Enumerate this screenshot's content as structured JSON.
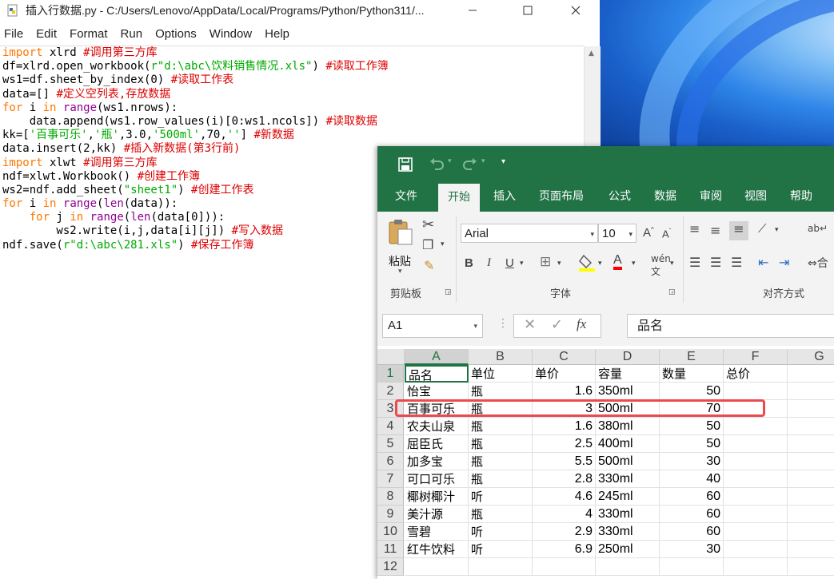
{
  "idle": {
    "title": "插入行数据.py - C:/Users/Lenovo/AppData/Local/Programs/Python/Python311/...",
    "menu": [
      "File",
      "Edit",
      "Format",
      "Run",
      "Options",
      "Window",
      "Help"
    ],
    "code": [
      [
        {
          "t": "import",
          "c": "kw"
        },
        {
          "t": " xlrd "
        },
        {
          "t": "#调用第三方库",
          "c": "cm"
        }
      ],
      [
        {
          "t": "df=xlrd.open_workbook("
        },
        {
          "t": "r\"d:\\abc\\饮料销售情况.xls\"",
          "c": "st"
        },
        {
          "t": ") "
        },
        {
          "t": "#读取工作簿",
          "c": "cm"
        }
      ],
      [
        {
          "t": "ws1=df.sheet_by_index(0) "
        },
        {
          "t": "#读取工作表",
          "c": "cm"
        }
      ],
      [
        {
          "t": "data=[] "
        },
        {
          "t": "#定义空列表,存放数据",
          "c": "cm"
        }
      ],
      [
        {
          "t": "for",
          "c": "kw"
        },
        {
          "t": " i "
        },
        {
          "t": "in",
          "c": "kw"
        },
        {
          "t": " "
        },
        {
          "t": "range",
          "c": "bi"
        },
        {
          "t": "(ws1.nrows):"
        }
      ],
      [
        {
          "t": "    data.append(ws1.row_values(i)[0:ws1.ncols]) "
        },
        {
          "t": "#读取数据",
          "c": "cm"
        }
      ],
      [
        {
          "t": "kk=["
        },
        {
          "t": "'百事可乐'",
          "c": "st"
        },
        {
          "t": ","
        },
        {
          "t": "'瓶'",
          "c": "st"
        },
        {
          "t": ",3.0,"
        },
        {
          "t": "'500ml'",
          "c": "st"
        },
        {
          "t": ",70,"
        },
        {
          "t": "''",
          "c": "st"
        },
        {
          "t": "] "
        },
        {
          "t": "#新数据",
          "c": "cm"
        }
      ],
      [
        {
          "t": "data.insert(2,kk) "
        },
        {
          "t": "#插入新数据(第3行前)",
          "c": "cm"
        }
      ],
      [
        {
          "t": "import",
          "c": "kw"
        },
        {
          "t": " xlwt "
        },
        {
          "t": "#调用第三方库",
          "c": "cm"
        }
      ],
      [
        {
          "t": "ndf=xlwt.Workbook() "
        },
        {
          "t": "#创建工作簿",
          "c": "cm"
        }
      ],
      [
        {
          "t": "ws2=ndf.add_sheet("
        },
        {
          "t": "\"sheet1\"",
          "c": "st"
        },
        {
          "t": ") "
        },
        {
          "t": "#创建工作表",
          "c": "cm"
        }
      ],
      [
        {
          "t": "for",
          "c": "kw"
        },
        {
          "t": " i "
        },
        {
          "t": "in",
          "c": "kw"
        },
        {
          "t": " "
        },
        {
          "t": "range",
          "c": "bi"
        },
        {
          "t": "("
        },
        {
          "t": "len",
          "c": "bi"
        },
        {
          "t": "(data)):"
        }
      ],
      [
        {
          "t": "    "
        },
        {
          "t": "for",
          "c": "kw"
        },
        {
          "t": " j "
        },
        {
          "t": "in",
          "c": "kw"
        },
        {
          "t": " "
        },
        {
          "t": "range",
          "c": "bi"
        },
        {
          "t": "("
        },
        {
          "t": "len",
          "c": "bi"
        },
        {
          "t": "(data[0])):"
        }
      ],
      [
        {
          "t": "        ws2.write(i,j,data[i][j]) "
        },
        {
          "t": "#写入数据",
          "c": "cm"
        }
      ],
      [
        {
          "t": "ndf.save("
        },
        {
          "t": "r\"d:\\abc\\281.xls\"",
          "c": "st"
        },
        {
          "t": ") "
        },
        {
          "t": "#保存工作簿",
          "c": "cm"
        }
      ]
    ]
  },
  "excel": {
    "tabs": [
      "文件",
      "开始",
      "插入",
      "页面布局",
      "公式",
      "数据",
      "审阅",
      "视图",
      "帮助"
    ],
    "active_tab": "开始",
    "font_name": "Arial",
    "font_size": "10",
    "paste_label": "粘贴",
    "clipboard_label": "剪贴板",
    "font_group_label": "字体",
    "align_group_label": "对齐方式",
    "cell_ref": "A1",
    "formula_content": "品名",
    "columns": [
      "A",
      "B",
      "C",
      "D",
      "E",
      "F",
      "G"
    ],
    "rows": [
      [
        "品名",
        "单位",
        "单价",
        "容量",
        "数量",
        "总价"
      ],
      [
        "怡宝",
        "瓶",
        "1.6",
        "350ml",
        "50",
        ""
      ],
      [
        "百事可乐",
        "瓶",
        "3",
        "500ml",
        "70",
        ""
      ],
      [
        "农夫山泉",
        "瓶",
        "1.6",
        "380ml",
        "50",
        ""
      ],
      [
        "屈臣氏",
        "瓶",
        "2.5",
        "400ml",
        "50",
        ""
      ],
      [
        "加多宝",
        "瓶",
        "5.5",
        "500ml",
        "30",
        ""
      ],
      [
        "可口可乐",
        "瓶",
        "2.8",
        "330ml",
        "40",
        ""
      ],
      [
        "椰树椰汁",
        "听",
        "4.6",
        "245ml",
        "60",
        ""
      ],
      [
        "美汁源",
        "瓶",
        "4",
        "330ml",
        "60",
        ""
      ],
      [
        "雪碧",
        "听",
        "2.9",
        "330ml",
        "60",
        ""
      ],
      [
        "红牛饮料",
        "听",
        "6.9",
        "250ml",
        "30",
        ""
      ],
      [
        "",
        "",
        "",
        "",
        "",
        ""
      ]
    ],
    "colors": {
      "brand": "#217346",
      "highlight": "#ea4b50"
    }
  }
}
